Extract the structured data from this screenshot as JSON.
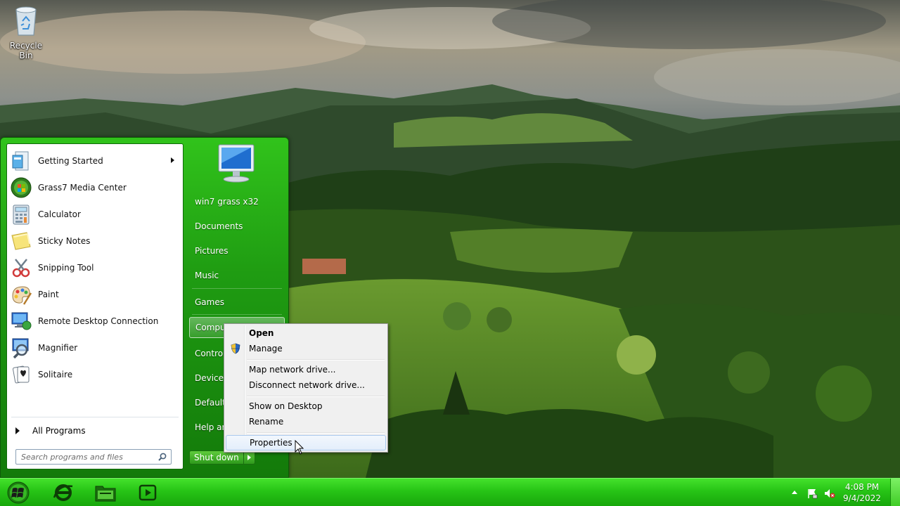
{
  "desktop": {
    "icons": [
      {
        "label": "Recycle Bin",
        "icon": "recycle-bin-icon"
      }
    ]
  },
  "start_menu": {
    "programs": [
      {
        "label": "Getting Started",
        "icon": "getting-started-icon",
        "has_submenu": true
      },
      {
        "label": "Grass7 Media Center",
        "icon": "media-center-icon",
        "has_submenu": false
      },
      {
        "label": "Calculator",
        "icon": "calculator-icon",
        "has_submenu": false
      },
      {
        "label": "Sticky Notes",
        "icon": "sticky-notes-icon",
        "has_submenu": false
      },
      {
        "label": "Snipping Tool",
        "icon": "snipping-tool-icon",
        "has_submenu": false
      },
      {
        "label": "Paint",
        "icon": "paint-icon",
        "has_submenu": false
      },
      {
        "label": "Remote Desktop Connection",
        "icon": "remote-desktop-icon",
        "has_submenu": false
      },
      {
        "label": "Magnifier",
        "icon": "magnifier-icon",
        "has_submenu": false
      },
      {
        "label": "Solitaire",
        "icon": "solitaire-icon",
        "has_submenu": false
      }
    ],
    "all_programs": "All Programs",
    "search_placeholder": "Search programs and files",
    "right_items": {
      "user": "win7 grass x32",
      "documents": "Documents",
      "pictures": "Pictures",
      "music": "Music",
      "games": "Games",
      "computer": "Computer",
      "control_panel": "Control Panel",
      "devices": "Devices and Printers",
      "default_programs": "Default Programs",
      "help": "Help and Support"
    },
    "shutdown_label": "Shut down"
  },
  "context_menu": {
    "items": [
      {
        "label": "Open",
        "bold": true
      },
      {
        "label": "Manage",
        "icon": "uac-shield-icon"
      },
      {
        "label": "Map network drive..."
      },
      {
        "label": "Disconnect network drive..."
      },
      {
        "label": "Show on Desktop"
      },
      {
        "label": "Rename"
      },
      {
        "label": "Properties",
        "highlighted": true
      }
    ]
  },
  "taskbar": {
    "pinned": [
      {
        "name": "internet-explorer",
        "icon": "internet-explorer-icon"
      },
      {
        "name": "windows-explorer",
        "icon": "folder-icon"
      },
      {
        "name": "media-player",
        "icon": "media-player-icon"
      }
    ],
    "tray_icons": [
      "show-hidden-icons-arrow",
      "action-center-flag-icon",
      "volume-muted-icon"
    ],
    "clock": {
      "time": "4:08 PM",
      "date": "9/4/2022"
    }
  },
  "colors": {
    "start_menu_green": "#1f9c12",
    "taskbar_green": "#27c416",
    "context_menu_bg": "#f0f0f0",
    "highlight_border": "#aac9ee"
  }
}
